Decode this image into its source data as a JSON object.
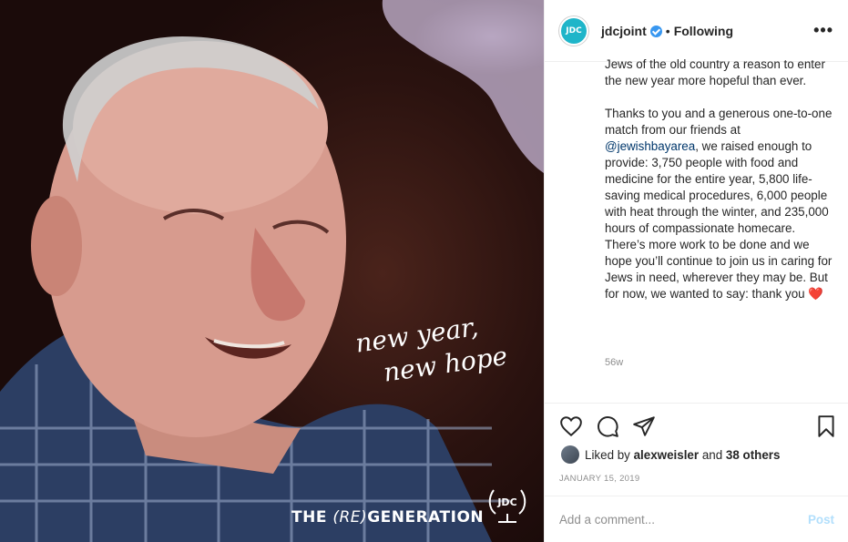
{
  "post": {
    "brand_text_the": "THE",
    "brand_text_re": "(RE)",
    "brand_text_generation": "GENERATION",
    "handwriting_line1": "new year,",
    "handwriting_line2": "new hope",
    "logo_text": "JDC"
  },
  "header": {
    "avatar_text": "JDC",
    "username": "jdcjoint",
    "separator": "•",
    "following_label": "Following",
    "more_label": "•••",
    "colors": {
      "avatar_bg": "#1fb5c9",
      "verified": "#3897f0"
    }
  },
  "caption": {
    "para1": "Jews of the old country a reason to enter the new year more hopeful than ever.",
    "para2_before": "Thanks to you and a generous one-to-one match from our friends at ",
    "para2_mention": "@jewishbayarea",
    "para2_after": ", we raised enough to provide: 3,750 people with food and medicine for the entire year, 5,800 life-saving medical procedures, 6,000 people with heat through the winter, and 235,000 hours of compassionate homecare. There’s more work to be done and we hope you’ll continue to join us in caring for Jews in need, wherever they may be. But for now, we wanted to say: thank you ",
    "heart": "❤️",
    "age": "56w"
  },
  "actions": {
    "icons": [
      "heart-outline-icon",
      "comment-icon",
      "share-icon",
      "bookmark-icon"
    ]
  },
  "likes": {
    "prefix": "Liked by ",
    "user": "alexweisler",
    "middle": " and ",
    "others": "38 others"
  },
  "date": "JANUARY 15, 2019",
  "comment": {
    "placeholder": "Add a comment...",
    "post_label": "Post"
  }
}
